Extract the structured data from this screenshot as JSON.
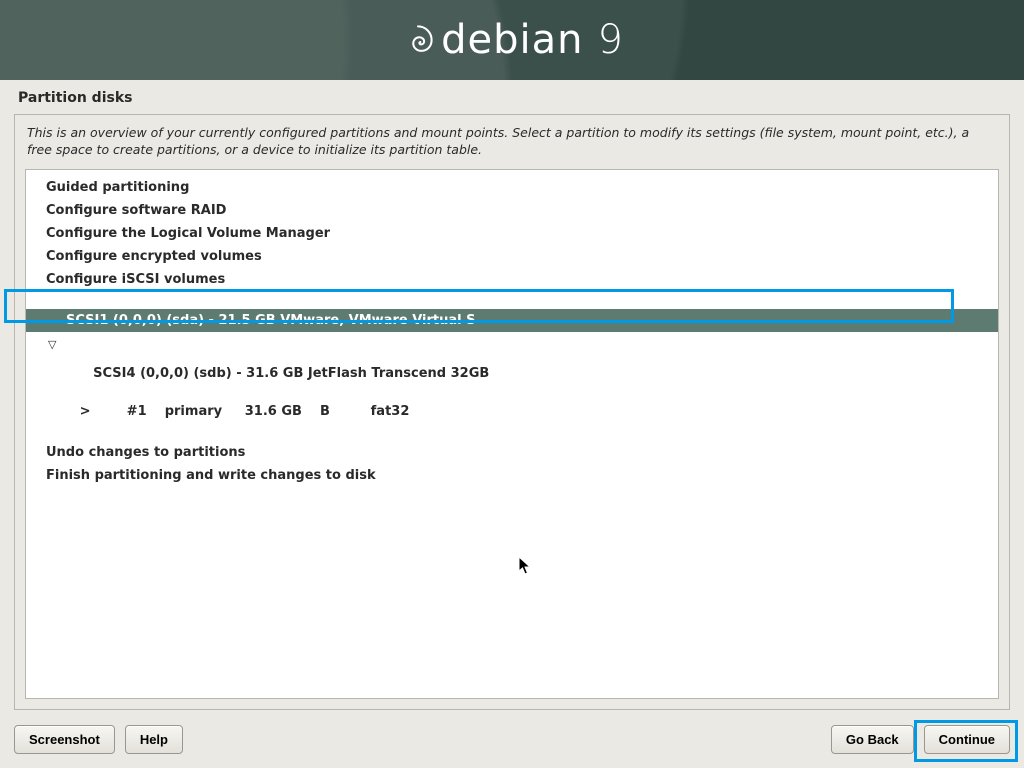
{
  "brand": {
    "name": "debian",
    "version": "9"
  },
  "page_title": "Partition disks",
  "intro": "This is an overview of your currently configured partitions and mount points. Select a partition to modify its settings (file system, mount point, etc.), a free space to create partitions, or a device to initialize its partition table.",
  "options": {
    "guided": "Guided partitioning",
    "raid": "Configure software RAID",
    "lvm": "Configure the Logical Volume Manager",
    "enc": "Configure encrypted volumes",
    "iscsi": "Configure iSCSI volumes"
  },
  "disks": {
    "sda": "SCSI1 (0,0,0) (sda) - 21.5 GB VMware, VMware Virtual S",
    "sdb": "SCSI4 (0,0,0) (sdb) - 31.6 GB JetFlash Transcend 32GB",
    "sdb_p1": "   >        #1    primary     31.6 GB    B         fat32"
  },
  "actions": {
    "undo": "Undo changes to partitions",
    "finish": "Finish partitioning and write changes to disk"
  },
  "buttons": {
    "screenshot": "Screenshot",
    "help": "Help",
    "goback": "Go Back",
    "continue": "Continue"
  }
}
